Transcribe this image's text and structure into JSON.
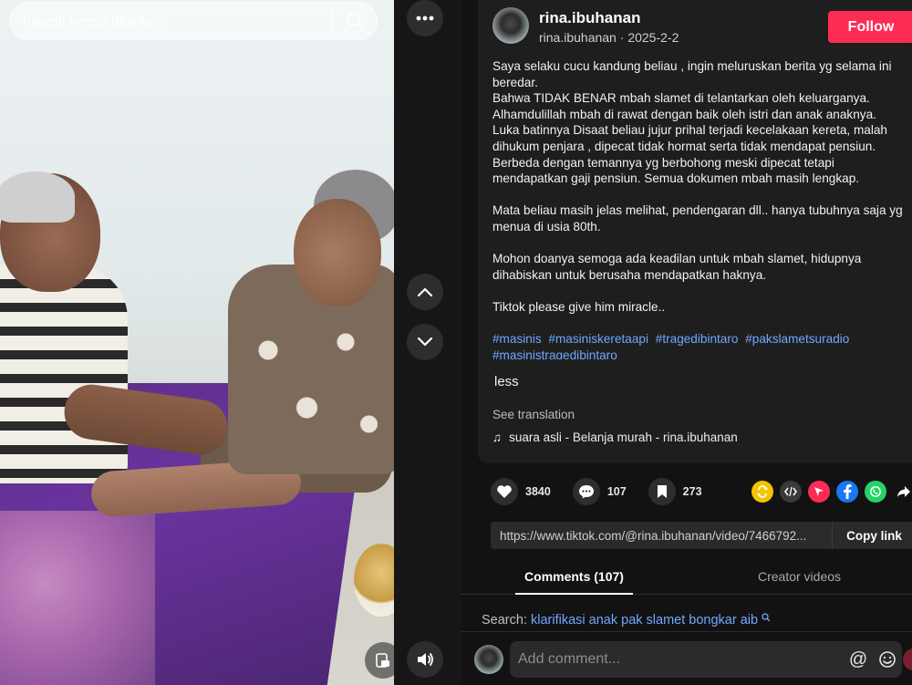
{
  "search": {
    "query": "tragedi kereta dibintaro"
  },
  "author": {
    "display_name": "rina.ibuhanan",
    "handle": "rina.ibuhanan",
    "date": "2025-2-2",
    "separator": "·"
  },
  "follow_label": "Follow",
  "description": {
    "lines": [
      "Saya selaku cucu kandung beliau , ingin meluruskan berita yg selama ini beredar.",
      "Bahwa TIDAK BENAR mbah slamet di telantarkan oleh keluarganya.",
      "Alhamdulillah mbah di rawat dengan baik oleh istri dan anak anaknya.",
      "Luka batinnya Disaat beliau jujur prihal terjadi kecelakaan kereta, malah dihukum penjara , dipecat tidak hormat serta tidak mendapat pensiun.",
      "Berbeda dengan temannya yg berbohong meski dipecat tetapi mendapatkan gaji pensiun. Semua dokumen mbah masih lengkap."
    ],
    "para2": "Mata beliau masih jelas melihat, pendengaran dll.. hanya tubuhnya saja yg menua di usia 80th.",
    "para3": "Mohon doanya semoga ada keadilan untuk mbah slamet, hidupnya dihabiskan untuk berusaha mendapatkan haknya.",
    "para4": "Tiktok please give him miracle..",
    "hashtags": [
      "#masinis",
      "#masiniskeretaapi",
      "#tragedibintaro",
      "#pakslametsuradio",
      "#masinistragedibintaro"
    ]
  },
  "less_label": "less",
  "see_translation_label": "See translation",
  "music": {
    "note_icon": "♫",
    "text": "suara asli - Belanja murah - rina.ibuhanan"
  },
  "actions": {
    "likes": "3840",
    "comments": "107",
    "saves": "273"
  },
  "share_colors": {
    "repost": "#f5c400",
    "embed": "#3a3a3a",
    "direct": "#fe2c55",
    "facebook": "#1877f2",
    "whatsapp": "#25d366"
  },
  "link": {
    "url": "https://www.tiktok.com/@rina.ibuhanan/video/7466792...",
    "copy_label": "Copy link"
  },
  "tabs": {
    "comments": "Comments (107)",
    "creator_videos": "Creator videos"
  },
  "search_related": {
    "label": "Search:",
    "query": "klarifikasi anak pak slamet bongkar aib"
  },
  "comment_input": {
    "placeholder": "Add comment..."
  }
}
